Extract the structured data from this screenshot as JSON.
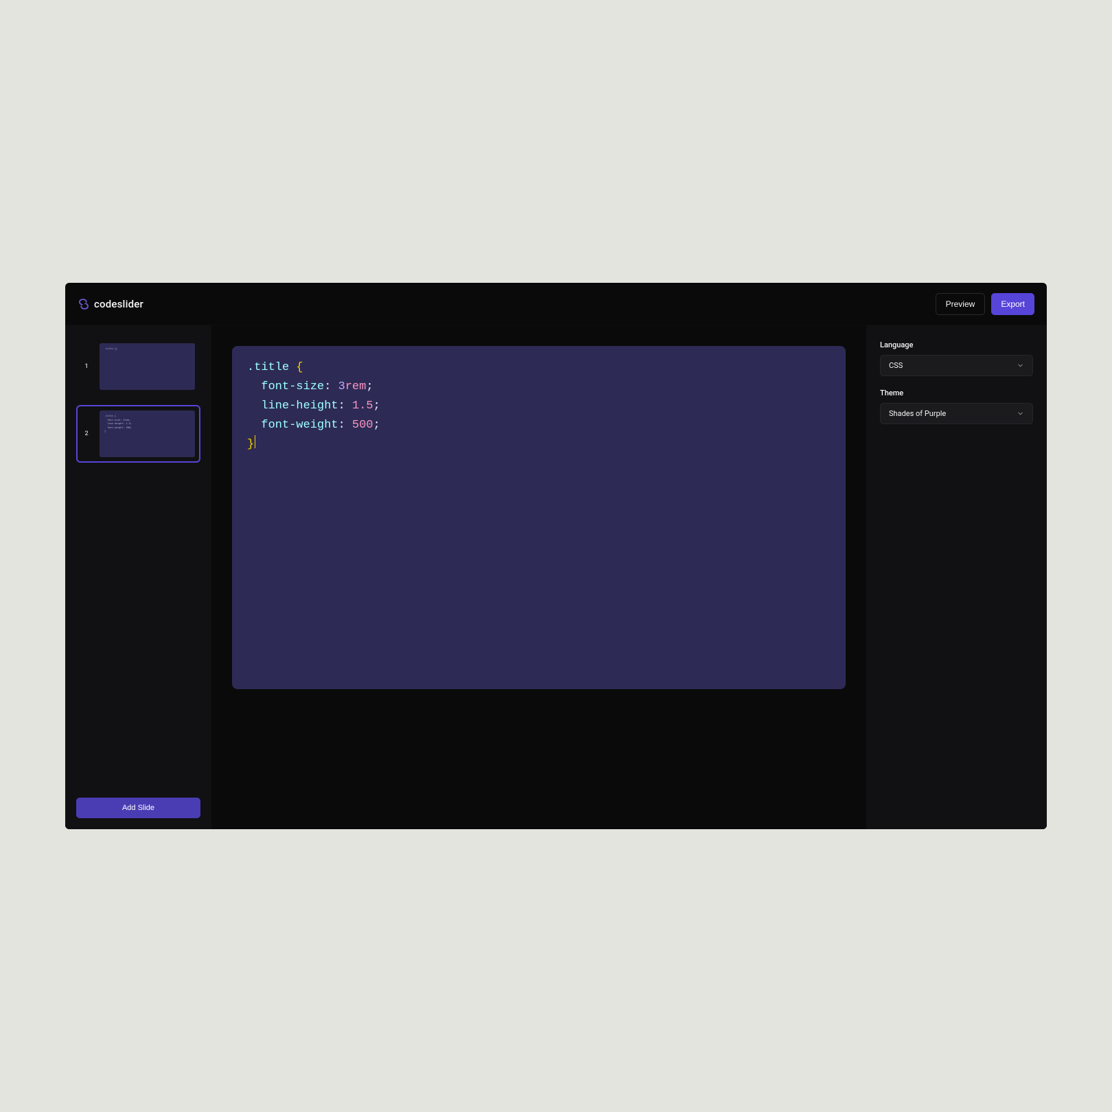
{
  "header": {
    "logo_text": "codeslider",
    "preview_label": "Preview",
    "export_label": "Export"
  },
  "sidebar": {
    "slides": [
      {
        "number": "1",
        "active": false,
        "preview": ".title {}"
      },
      {
        "number": "2",
        "active": true,
        "preview": ".title {\n  font-size: 3rem;\n  line-height: 1.5;\n  font-weight: 500;\n}"
      }
    ],
    "add_slide_label": "Add Slide"
  },
  "editor": {
    "code_tokens": [
      {
        "t": ".title",
        "c": "tok-sel"
      },
      {
        "t": " "
      },
      {
        "t": "{",
        "c": "tok-brace"
      },
      {
        "t": "\n  "
      },
      {
        "t": "font-size",
        "c": "tok-prop"
      },
      {
        "t": ":",
        "c": "tok-punct"
      },
      {
        "t": " "
      },
      {
        "t": "3",
        "c": "tok-numlead"
      },
      {
        "t": "rem",
        "c": "tok-unit"
      },
      {
        "t": ";",
        "c": "tok-punct"
      },
      {
        "t": "\n  "
      },
      {
        "t": "line-height",
        "c": "tok-prop"
      },
      {
        "t": ":",
        "c": "tok-punct"
      },
      {
        "t": " "
      },
      {
        "t": "1.5",
        "c": "tok-num"
      },
      {
        "t": ";",
        "c": "tok-punct"
      },
      {
        "t": "\n  "
      },
      {
        "t": "font-weight",
        "c": "tok-prop"
      },
      {
        "t": ":",
        "c": "tok-punct"
      },
      {
        "t": " "
      },
      {
        "t": "500",
        "c": "tok-num"
      },
      {
        "t": ";",
        "c": "tok-punct"
      },
      {
        "t": "\n"
      },
      {
        "t": "}",
        "c": "tok-brace"
      }
    ]
  },
  "panel": {
    "language_label": "Language",
    "language_value": "CSS",
    "theme_label": "Theme",
    "theme_value": "Shades of Purple"
  }
}
